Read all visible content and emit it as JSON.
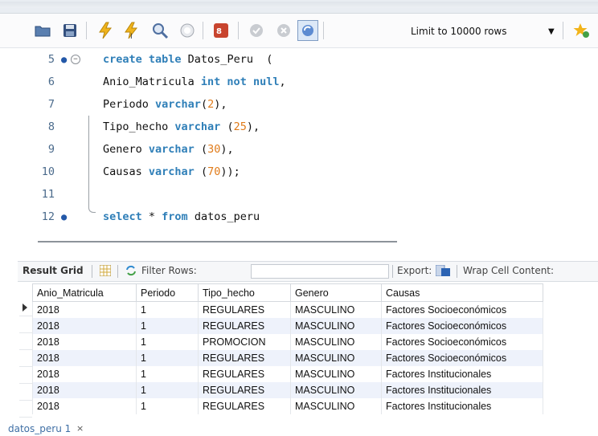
{
  "toolbar": {
    "icons": [
      "open-folder-icon",
      "save-icon",
      "execute-icon",
      "execute-current-icon",
      "explain-icon",
      "stop-icon",
      "toggle-continue-icon",
      "commit-icon",
      "rollback-icon",
      "autocommit-icon"
    ],
    "limit_label": "Limit to 10000 rows",
    "dropdown_glyph": "▼"
  },
  "editor": {
    "lines": [
      {
        "num": "5",
        "dot": "●",
        "tokens": [
          [
            "kw",
            "create table "
          ],
          [
            "plain",
            "Datos_Peru  ("
          ]
        ]
      },
      {
        "num": "6",
        "dot": "",
        "tokens": [
          [
            "plain",
            "Anio_Matricula "
          ],
          [
            "kw",
            "int not null"
          ],
          [
            "plain",
            ","
          ]
        ]
      },
      {
        "num": "7",
        "dot": "",
        "tokens": [
          [
            "plain",
            "Periodo "
          ],
          [
            "kw",
            "varchar"
          ],
          [
            "plain",
            "("
          ],
          [
            "num",
            "2"
          ],
          [
            "plain",
            "),"
          ]
        ]
      },
      {
        "num": "8",
        "dot": "",
        "tokens": [
          [
            "plain",
            "Tipo_hecho "
          ],
          [
            "kw",
            "varchar"
          ],
          [
            "plain",
            " ("
          ],
          [
            "num",
            "25"
          ],
          [
            "plain",
            "),"
          ]
        ]
      },
      {
        "num": "9",
        "dot": "",
        "tokens": [
          [
            "plain",
            "Genero "
          ],
          [
            "kw",
            "varchar"
          ],
          [
            "plain",
            " ("
          ],
          [
            "num",
            "30"
          ],
          [
            "plain",
            "),"
          ]
        ]
      },
      {
        "num": "10",
        "dot": "",
        "tokens": [
          [
            "plain",
            "Causas "
          ],
          [
            "kw",
            "varchar"
          ],
          [
            "plain",
            " ("
          ],
          [
            "num",
            "70"
          ],
          [
            "plain",
            "));"
          ]
        ]
      },
      {
        "num": "11",
        "dot": "",
        "tokens": []
      },
      {
        "num": "12",
        "dot": "●",
        "tokens": [
          [
            "kw",
            "select"
          ],
          [
            "plain",
            " * "
          ],
          [
            "kw",
            "from"
          ],
          [
            "plain",
            " datos_peru"
          ]
        ]
      }
    ]
  },
  "results": {
    "result_grid_label": "Result Grid",
    "filter_label": "Filter Rows:",
    "export_label": "Export:",
    "wrap_label": "Wrap Cell Content:",
    "columns": [
      "Anio_Matricula",
      "Periodo",
      "Tipo_hecho",
      "Genero",
      "Causas"
    ],
    "rows": [
      [
        "2018",
        "1",
        "REGULARES",
        "MASCULINO",
        "Factores Socioeconómicos"
      ],
      [
        "2018",
        "1",
        "REGULARES",
        "MASCULINO",
        "Factores Socioeconómicos"
      ],
      [
        "2018",
        "1",
        "PROMOCION",
        "MASCULINO",
        "Factores Socioeconómicos"
      ],
      [
        "2018",
        "1",
        "REGULARES",
        "MASCULINO",
        "Factores Socioeconómicos"
      ],
      [
        "2018",
        "1",
        "REGULARES",
        "MASCULINO",
        "Factores Institucionales"
      ],
      [
        "2018",
        "1",
        "REGULARES",
        "MASCULINO",
        "Factores Institucionales"
      ],
      [
        "2018",
        "1",
        "REGULARES",
        "MASCULINO",
        "Factores Institucionales"
      ]
    ]
  },
  "tab": {
    "label": "datos_peru 1",
    "close": "×"
  },
  "colors": {
    "keyword": "#2f7fb8",
    "number": "#e07b1a",
    "alt_row": "#eef2fb"
  }
}
